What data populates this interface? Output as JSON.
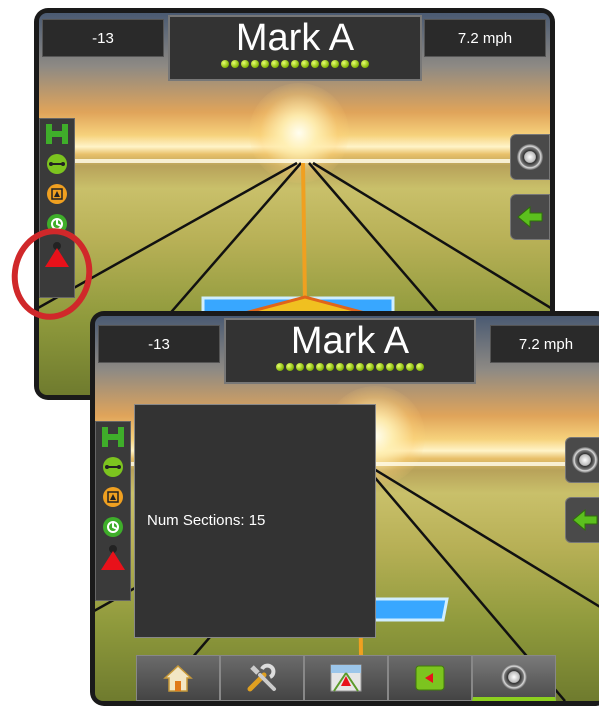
{
  "screen_top": {
    "title": "Mark A",
    "left_value": "-13",
    "speed": "7.2 mph"
  },
  "screen_bottom": {
    "title": "Mark A",
    "left_value": "-13",
    "speed": "7.2 mph",
    "popup_text": "Num Sections: 15"
  },
  "left_toolbar_icons": [
    "guidance-mode-icon",
    "ab-line-icon",
    "marker-icon",
    "section-control-icon",
    "vehicle-icon"
  ],
  "right_buttons": [
    "zoom-view-icon",
    "back-arrow-icon"
  ],
  "bottom_tabs": [
    "home-icon",
    "tools-icon",
    "guidance-view-icon",
    "mapping-icon",
    "settings-dial-icon"
  ],
  "colors": {
    "accent_green": "#8ccf1f",
    "highlight_red": "#d0282a",
    "guideline_orange": "#f0a020",
    "panel_dark": "#333333"
  }
}
